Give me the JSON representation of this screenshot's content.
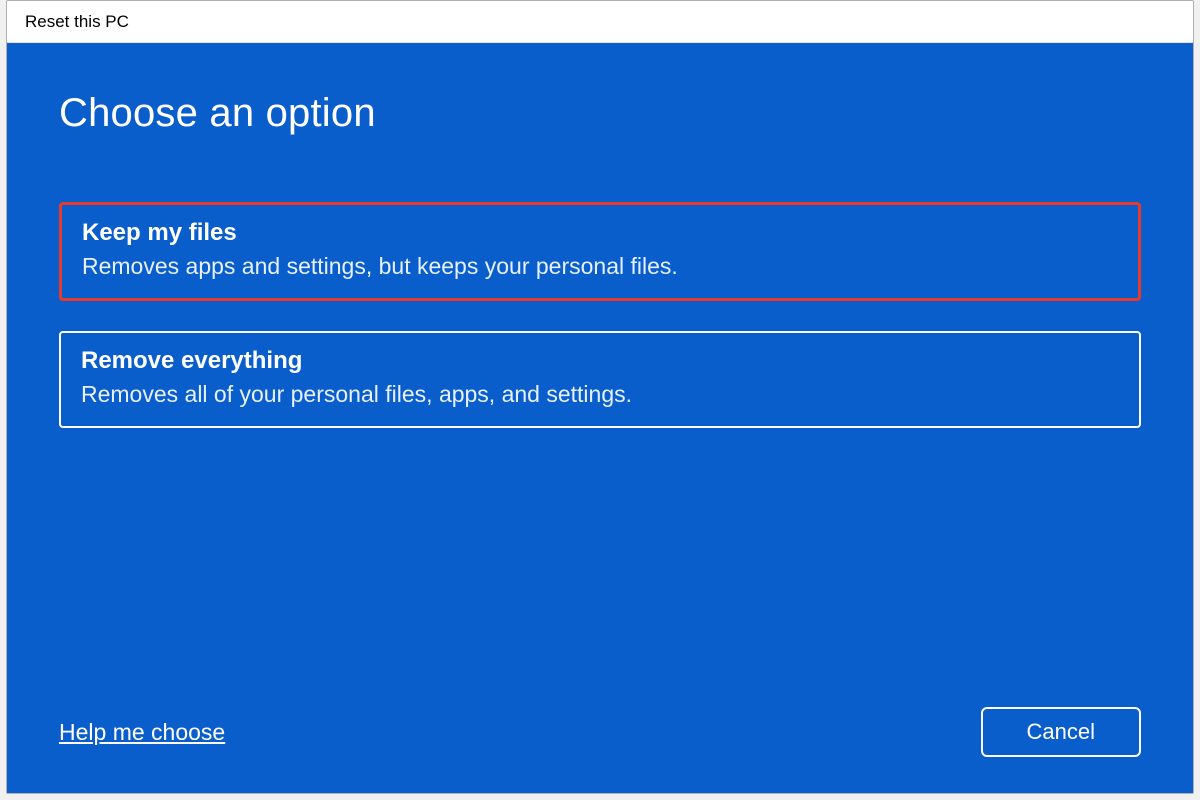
{
  "window": {
    "title": "Reset this PC"
  },
  "main": {
    "heading": "Choose an option",
    "options": [
      {
        "title": "Keep my files",
        "description": "Removes apps and settings, but keeps your personal files.",
        "highlighted": true
      },
      {
        "title": "Remove everything",
        "description": "Removes all of your personal files, apps, and settings.",
        "highlighted": false
      }
    ]
  },
  "footer": {
    "help_link": "Help me choose",
    "cancel_label": "Cancel"
  },
  "colors": {
    "accent": "#0a5ecb",
    "highlight_border": "#e63a2a"
  }
}
